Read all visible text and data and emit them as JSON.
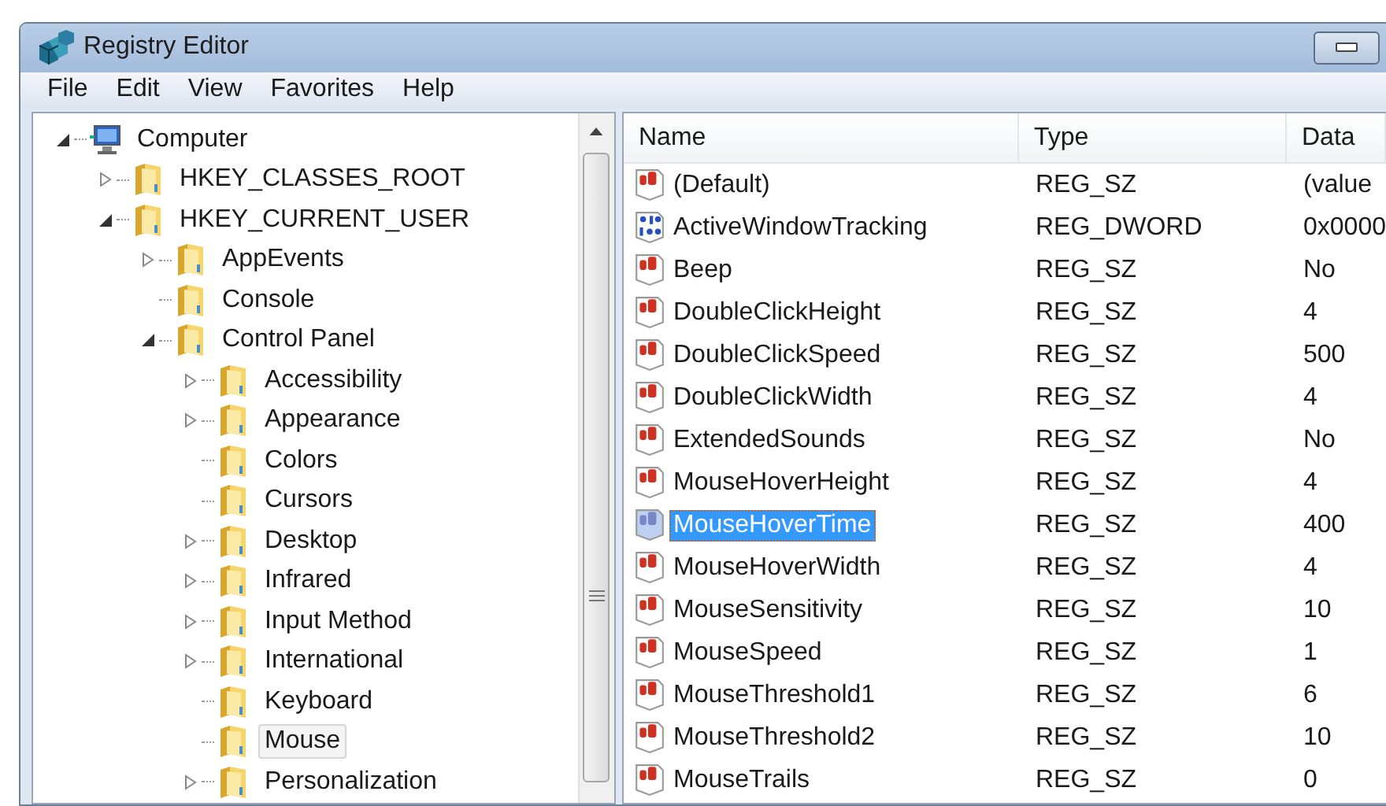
{
  "window": {
    "title": "Registry Editor"
  },
  "menu": [
    "File",
    "Edit",
    "View",
    "Favorites",
    "Help"
  ],
  "tree": [
    {
      "label": "Computer",
      "kind": "computer",
      "expanded": true,
      "selected": false,
      "children": [
        {
          "label": "HKEY_CLASSES_ROOT",
          "kind": "folder",
          "expanded": false,
          "selected": false
        },
        {
          "label": "HKEY_CURRENT_USER",
          "kind": "folder",
          "expanded": true,
          "selected": false,
          "children": [
            {
              "label": "AppEvents",
              "kind": "folder",
              "expanded": false,
              "selected": false
            },
            {
              "label": "Console",
              "kind": "folder",
              "selected": false
            },
            {
              "label": "Control Panel",
              "kind": "folder",
              "expanded": true,
              "selected": false,
              "children": [
                {
                  "label": "Accessibility",
                  "kind": "folder",
                  "expanded": false,
                  "selected": false
                },
                {
                  "label": "Appearance",
                  "kind": "folder",
                  "expanded": false,
                  "selected": false
                },
                {
                  "label": "Colors",
                  "kind": "folder",
                  "selected": false
                },
                {
                  "label": "Cursors",
                  "kind": "folder",
                  "selected": false
                },
                {
                  "label": "Desktop",
                  "kind": "folder",
                  "expanded": false,
                  "selected": false
                },
                {
                  "label": "Infrared",
                  "kind": "folder",
                  "expanded": false,
                  "selected": false
                },
                {
                  "label": "Input Method",
                  "kind": "folder",
                  "expanded": false,
                  "selected": false
                },
                {
                  "label": "International",
                  "kind": "folder",
                  "expanded": false,
                  "selected": false
                },
                {
                  "label": "Keyboard",
                  "kind": "folder",
                  "selected": false
                },
                {
                  "label": "Mouse",
                  "kind": "folder",
                  "selected": true
                },
                {
                  "label": "Personalization",
                  "kind": "folder",
                  "expanded": false,
                  "selected": false
                }
              ]
            }
          ]
        }
      ]
    }
  ],
  "table": {
    "columns": [
      "Name",
      "Type",
      "Data"
    ],
    "rows": [
      {
        "kind": "string",
        "name": "(Default)",
        "type": "REG_SZ",
        "data": "(value",
        "selected": false
      },
      {
        "kind": "dword",
        "name": "ActiveWindowTracking",
        "type": "REG_DWORD",
        "data": "0x0000",
        "selected": false
      },
      {
        "kind": "string",
        "name": "Beep",
        "type": "REG_SZ",
        "data": "No",
        "selected": false
      },
      {
        "kind": "string",
        "name": "DoubleClickHeight",
        "type": "REG_SZ",
        "data": "4",
        "selected": false
      },
      {
        "kind": "string",
        "name": "DoubleClickSpeed",
        "type": "REG_SZ",
        "data": "500",
        "selected": false
      },
      {
        "kind": "string",
        "name": "DoubleClickWidth",
        "type": "REG_SZ",
        "data": "4",
        "selected": false
      },
      {
        "kind": "string",
        "name": "ExtendedSounds",
        "type": "REG_SZ",
        "data": "No",
        "selected": false
      },
      {
        "kind": "string",
        "name": "MouseHoverHeight",
        "type": "REG_SZ",
        "data": "4",
        "selected": false
      },
      {
        "kind": "string",
        "name": "MouseHoverTime",
        "type": "REG_SZ",
        "data": "400",
        "selected": true
      },
      {
        "kind": "string",
        "name": "MouseHoverWidth",
        "type": "REG_SZ",
        "data": "4",
        "selected": false
      },
      {
        "kind": "string",
        "name": "MouseSensitivity",
        "type": "REG_SZ",
        "data": "10",
        "selected": false
      },
      {
        "kind": "string",
        "name": "MouseSpeed",
        "type": "REG_SZ",
        "data": "1",
        "selected": false
      },
      {
        "kind": "string",
        "name": "MouseThreshold1",
        "type": "REG_SZ",
        "data": "6",
        "selected": false
      },
      {
        "kind": "string",
        "name": "MouseThreshold2",
        "type": "REG_SZ",
        "data": "10",
        "selected": false
      },
      {
        "kind": "string",
        "name": "MouseTrails",
        "type": "REG_SZ",
        "data": "0",
        "selected": false
      }
    ]
  }
}
